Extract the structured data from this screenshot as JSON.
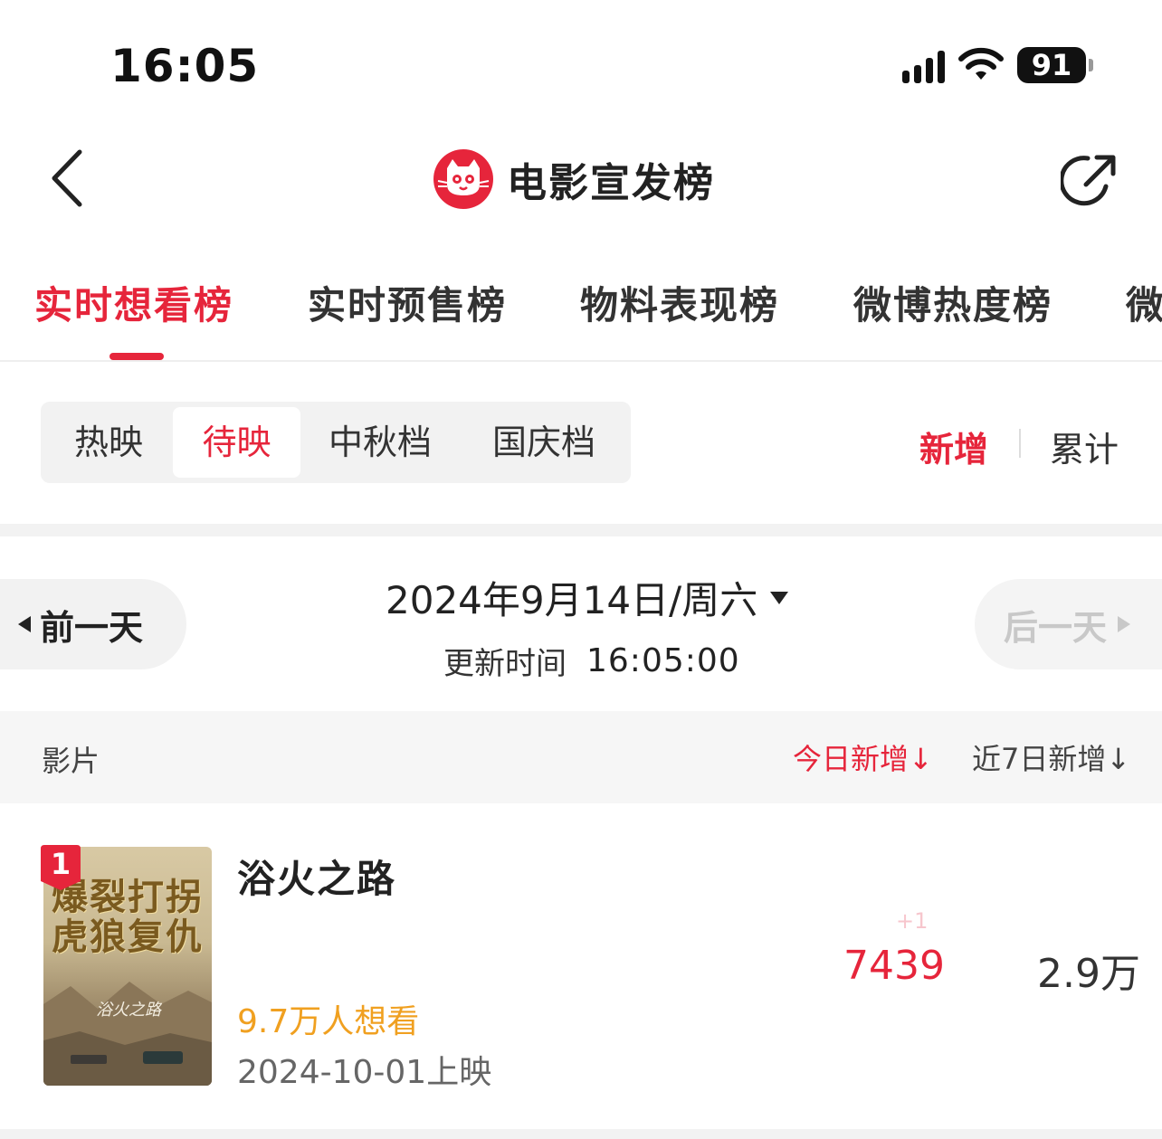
{
  "status_bar": {
    "time": "16:05",
    "battery": "91"
  },
  "header": {
    "title": "电影宣发榜"
  },
  "main_tabs": [
    {
      "label": "实时想看榜",
      "active": true
    },
    {
      "label": "实时预售榜",
      "active": false
    },
    {
      "label": "物料表现榜",
      "active": false
    },
    {
      "label": "微博热度榜",
      "active": false
    },
    {
      "label": "微",
      "active": false
    }
  ],
  "sub_tabs": [
    {
      "label": "热映",
      "active": false
    },
    {
      "label": "待映",
      "active": true
    },
    {
      "label": "中秋档",
      "active": false
    },
    {
      "label": "国庆档",
      "active": false
    }
  ],
  "toggle": {
    "new": "新增",
    "total": "累计"
  },
  "date_nav": {
    "prev": "前一天",
    "date": "2024年9月14日/周六",
    "update_label": "更新时间",
    "update_time": "16:05:00",
    "next": "后一天"
  },
  "table": {
    "col_film": "影片",
    "col_today": "今日新增↓",
    "col_7day": "近7日新增↓"
  },
  "movies": [
    {
      "rank": "1",
      "poster_line1": "爆裂打拐",
      "poster_line2": "虎狼复仇",
      "title": "浴火之路",
      "want": "9.7万人想看",
      "release": "2024-10-01上映",
      "delta": "+1",
      "today": "7439",
      "week": "2.9万"
    }
  ],
  "colors": {
    "accent": "#e6253b",
    "want": "#f0a020",
    "disabled": "#c8c8c8"
  }
}
